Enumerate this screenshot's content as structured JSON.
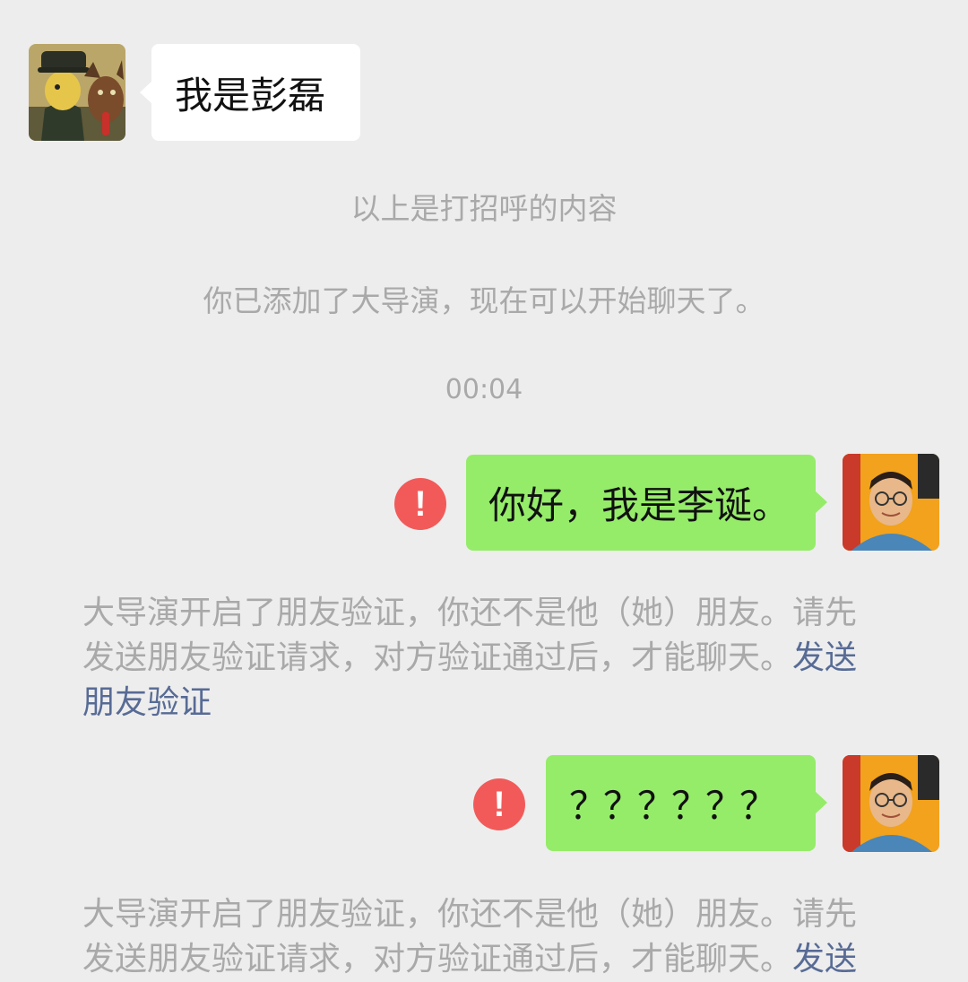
{
  "messages": {
    "incoming_text": "我是彭磊",
    "greeting_note": "以上是打招呼的内容",
    "added_note": "你已添加了大导演，现在可以开始聊天了。",
    "timestamp": "00:04",
    "outgoing_1": "你好，我是李诞。",
    "outgoing_2": "？？？？？？"
  },
  "notice": {
    "line1": "大导演开启了朋友验证，你还不是他（她）朋友。请先",
    "line2_text": "发送朋友验证请求，对方验证通过后，才能聊天。",
    "line2_link": "发送",
    "line3_link": "朋友验证"
  },
  "error_icon_glyph": "!",
  "colors": {
    "background": "#ededed",
    "bubble_green": "#95ec69",
    "bubble_white": "#ffffff",
    "system_text": "#a9a9a9",
    "link": "#576b95",
    "error_red": "#f25a5a"
  },
  "icons": {
    "error": "exclamation-circle-icon"
  }
}
